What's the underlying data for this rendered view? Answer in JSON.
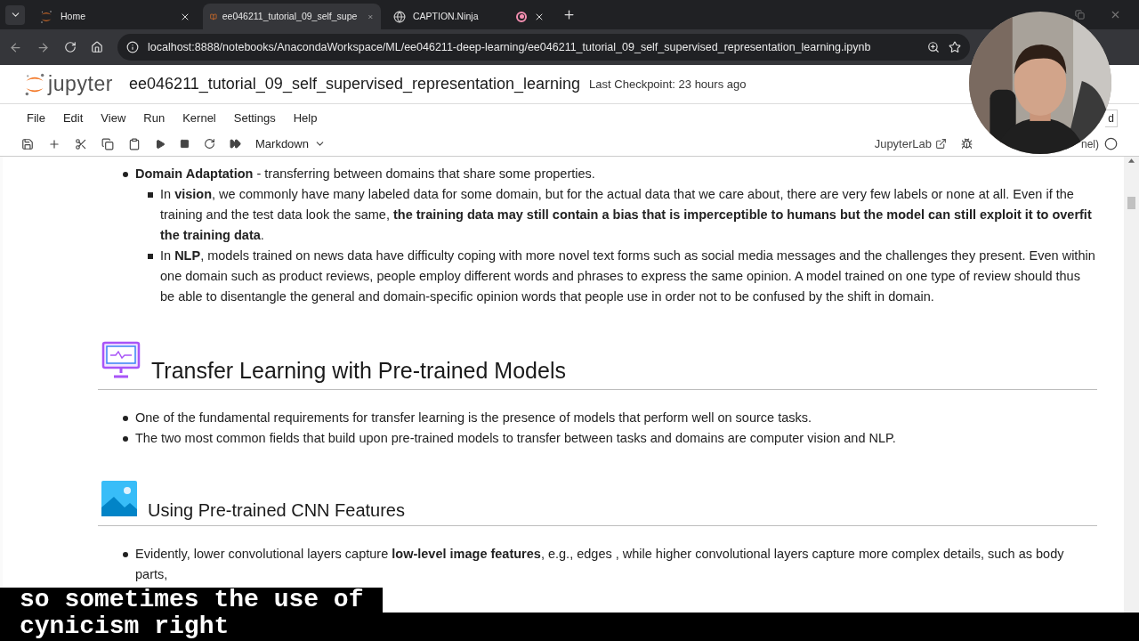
{
  "browser": {
    "tabs": [
      {
        "title": "Home",
        "kind": "jupyter",
        "selected": false,
        "recording": false
      },
      {
        "title": "ee046211_tutorial_09_self_supe",
        "kind": "notebook",
        "selected": true,
        "recording": false
      },
      {
        "title": "CAPTION.Ninja",
        "kind": "web",
        "selected": false,
        "recording": true
      }
    ],
    "url": "localhost:8888/notebooks/AnacondaWorkspace/ML/ee046211-deep-learning/ee046211_tutorial_09_self_supervised_representation_learning.ipynb"
  },
  "header": {
    "notebook_title": "ee046211_tutorial_09_self_supervised_representation_learning",
    "checkpoint": "Last Checkpoint: 23 hours ago"
  },
  "menu": [
    "File",
    "Edit",
    "View",
    "Run",
    "Kernel",
    "Settings",
    "Help"
  ],
  "trusted_fragment": "d",
  "toolbar": {
    "cell_type": "Markdown",
    "jupyterlab": "JupyterLab",
    "kernel_fragment": "nel)"
  },
  "blocks": [
    {
      "kind": "bullets",
      "items": [
        {
          "text": "**Domain Adaptation** - transferring between domains that share some properties.",
          "children": [
            {
              "text": "In **vision**, we commonly have many labeled data for some domain, but for the actual data that we care about, there are very few labels or none at all. Even if the training and the test data look the same, **the training data may still contain a bias that is imperceptible to humans but the model can still exploit it to overfit the training data**."
            },
            {
              "text": "In **NLP**, models trained on news data have difficulty coping with more novel text forms such as social media messages and the challenges they present. Even within one domain such as product reviews, people employ different words and phrases to express the same opinion. A model trained on one type of review should thus be able to disentangle the general and domain-specific opinion words that people use in order not to be confused by the shift in domain."
            }
          ]
        }
      ]
    },
    {
      "kind": "heading",
      "text": "Transfer Learning with Pre-trained Models"
    },
    {
      "kind": "bullets",
      "items": [
        {
          "text": "One of the fundamental requirements for transfer learning is the presence of models that perform well on source tasks."
        },
        {
          "text": "The two most common fields that build upon pre-trained models to transfer between tasks and domains are computer vision and NLP."
        }
      ]
    },
    {
      "kind": "subheading",
      "text": "Using Pre-trained CNN Features"
    },
    {
      "kind": "bullets",
      "items": [
        {
          "text": "Evidently, lower convolutional layers capture **low-level image features**, e.g., edges , while higher convolutional layers capture more complex details, such as body parts,"
        }
      ]
    }
  ],
  "webcam": {
    "kind": "picture"
  },
  "captions": [
    "so sometimes the use of",
    "cynicism right"
  ]
}
